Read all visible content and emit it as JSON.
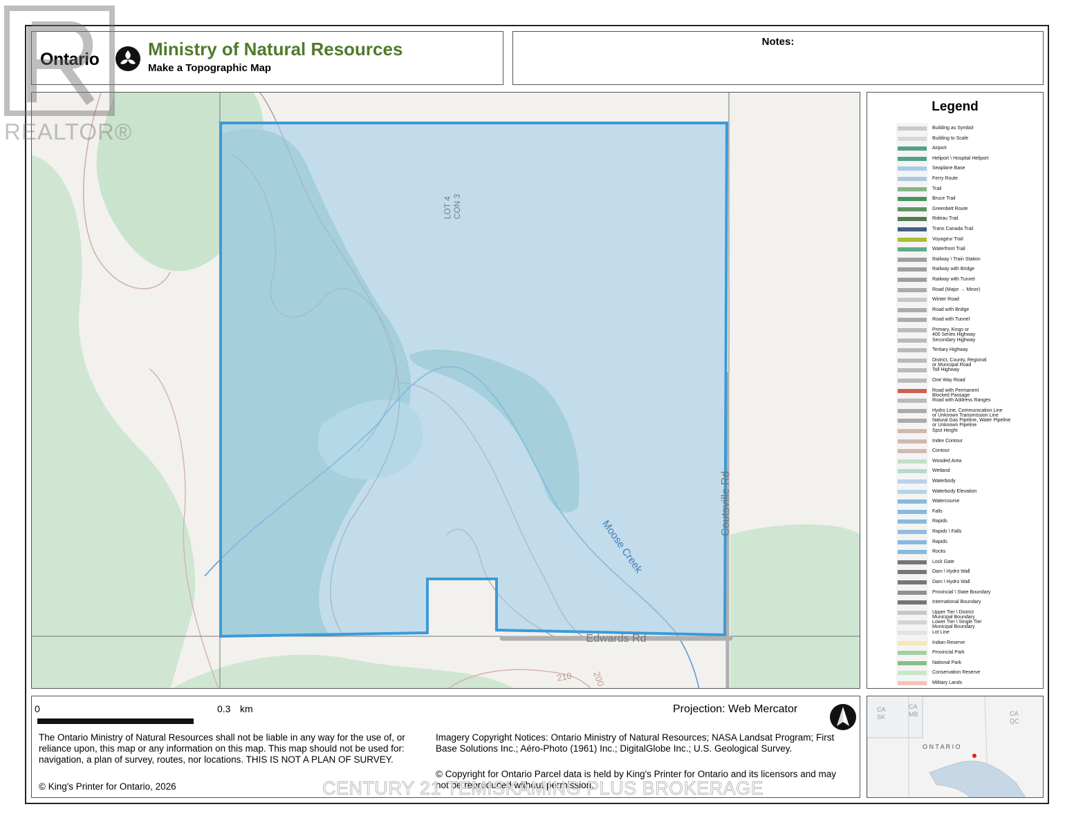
{
  "header": {
    "ontario_wordmark": "Ontario",
    "ministry": "Ministry of Natural Resources",
    "subtitle": "Make a Topographic Map"
  },
  "notes": {
    "label": "Notes:"
  },
  "map": {
    "labels": {
      "lot": "LOT 4\nCON 3",
      "creek": "Moose Creek",
      "road_south": "Edwards Rd",
      "road_east": "Coutsville Rd",
      "contour_210": "210",
      "contour_200": "200"
    },
    "colors": {
      "parcel_fill": "#b9d9ef",
      "parcel_stroke": "#3c9ad6",
      "wooded": "#c8e3cd",
      "contour": "#c9a79f",
      "water": "#5a9ed4"
    }
  },
  "legend": {
    "title": "Legend",
    "items": [
      "Building as Symbol",
      "Building to Scale",
      "Airport",
      "Heliport \\ Hospital Heliport",
      "Seaplane Base",
      "Ferry Route",
      "Trail",
      "Bruce Trail",
      "Greenbelt Route",
      "Rideau Trail",
      "Trans Canada Trail",
      "Voyageur Trail",
      "Waterfront Trail",
      "Railway \\ Train Station",
      "Railway with Bridge",
      "Railway with Tunnel",
      "Road (Major → Minor)",
      "Winter Road",
      "Road with Bridge",
      "Road with Tunnel",
      "Primary, Kings or\n400 Series Highway",
      "Secondary Highway",
      "Tertiary Highway",
      "District, County, Regional\nor Municipal Road",
      "Toll Highway",
      "One Way Road",
      "Road with Permanent\nBlocked Passage",
      "Road with Address Ranges",
      "Hydro Line, Communication Line\nor Unknown Transmission Line",
      "Natural Gas Pipeline, Water Pipeline\nor Unknown Pipeline",
      "Spot Height",
      "Index Contour",
      "Contour",
      "Wooded Area",
      "Wetland",
      "Waterbody",
      "Waterbody Elevation",
      "Watercourse",
      "Falls",
      "Rapids",
      "Rapids \\ Falls",
      "Rapids",
      "Rocks",
      "Lock Gate",
      "Dam \\ Hydro Wall",
      "Dam \\ Hydro Wall",
      "Provincial \\ State Boundary",
      "International Boundary",
      "Upper Tier \\ District\nMunicipal Boundary",
      "Lower Tier \\ Single Tier\nMunicipal Boundary",
      "Lot Line",
      "Indian Reserve",
      "Provincial Park",
      "National Park",
      "Conservation Reserve",
      "Military Lands"
    ]
  },
  "footer": {
    "scale_zero": "0",
    "scale_max": "0.3",
    "scale_unit": "km",
    "projection": "Projection: Web Mercator",
    "disclaimer": "The Ontario Ministry of Natural Resources shall not be liable in any way for the use of, or reliance upon, this map or any information on this map.  This map should not be used for: navigation, a plan of survey, routes, nor locations. THIS IS NOT A PLAN OF SURVEY.",
    "kings_printer": "© King's Printer for Ontario,  2026",
    "imagery": "Imagery Copyright Notices: Ontario Ministry of Natural Resources; NASA Landsat Program; First Base Solutions Inc.; Aéro-Photo (1961) Inc.; DigitalGlobe Inc.; U.S. Geological Survey.",
    "parcel": "© Copyright for Ontario Parcel data is held by King's Printer for Ontario and its licensors and may not be reproduced without permission."
  },
  "inset": {
    "labels": {
      "ca_sk": "CA\nSK",
      "ca_mb": "CA\nMB",
      "ca_qc": "CA\nQC",
      "ontario": "O N T A R I O"
    }
  },
  "watermarks": {
    "realtor": "REALTOR®",
    "brokerage": "CENTURY 21 TEMISKAMING PLUS BROKERAGE"
  }
}
